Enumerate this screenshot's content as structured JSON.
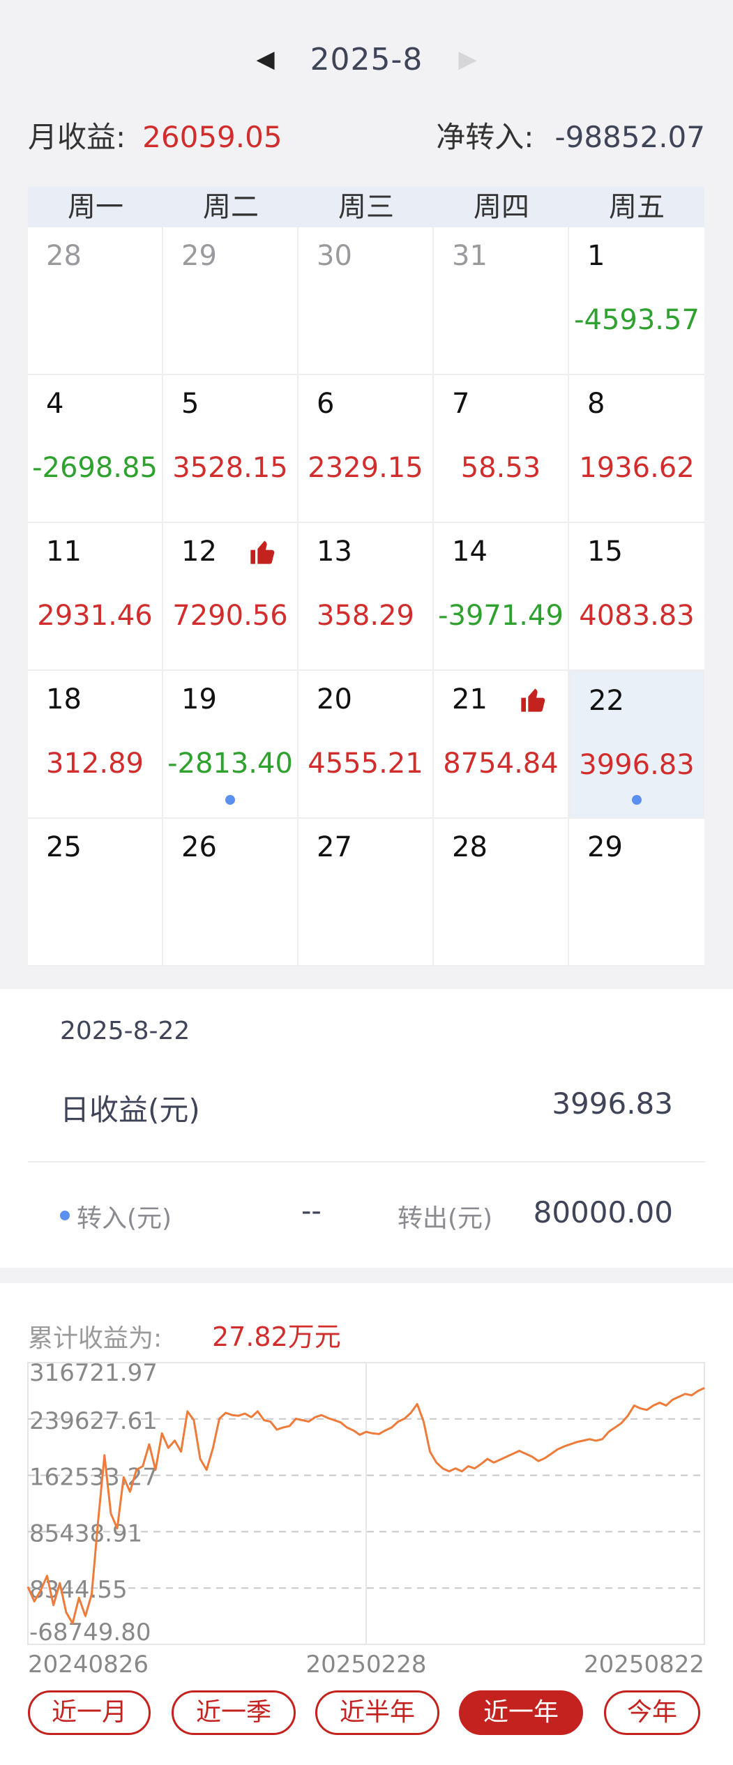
{
  "header": {
    "month": "2025-8",
    "prev_icon": "◀",
    "next_icon": "▶"
  },
  "summary": {
    "month_income_label": "月收益:",
    "month_income_value": "26059.05",
    "net_transfer_label": "净转入:",
    "net_transfer_value": "-98852.07"
  },
  "calendar": {
    "weekdays": [
      "周一",
      "周二",
      "周三",
      "周四",
      "周五"
    ],
    "days": [
      {
        "day": "28",
        "value": "",
        "other": true
      },
      {
        "day": "29",
        "value": "",
        "other": true
      },
      {
        "day": "30",
        "value": "",
        "other": true
      },
      {
        "day": "31",
        "value": "",
        "other": true
      },
      {
        "day": "1",
        "value": "-4593.57",
        "color": "green"
      },
      {
        "day": "4",
        "value": "-2698.85",
        "color": "green"
      },
      {
        "day": "5",
        "value": "3528.15",
        "color": "red"
      },
      {
        "day": "6",
        "value": "2329.15",
        "color": "red"
      },
      {
        "day": "7",
        "value": "58.53",
        "color": "red"
      },
      {
        "day": "8",
        "value": "1936.62",
        "color": "red"
      },
      {
        "day": "11",
        "value": "2931.46",
        "color": "red"
      },
      {
        "day": "12",
        "value": "7290.56",
        "color": "red",
        "thumb": true
      },
      {
        "day": "13",
        "value": "358.29",
        "color": "red"
      },
      {
        "day": "14",
        "value": "-3971.49",
        "color": "green"
      },
      {
        "day": "15",
        "value": "4083.83",
        "color": "red"
      },
      {
        "day": "18",
        "value": "312.89",
        "color": "red"
      },
      {
        "day": "19",
        "value": "-2813.40",
        "color": "green",
        "dot": true
      },
      {
        "day": "20",
        "value": "4555.21",
        "color": "red"
      },
      {
        "day": "21",
        "value": "8754.84",
        "color": "red",
        "thumb": true
      },
      {
        "day": "22",
        "value": "3996.83",
        "color": "red",
        "dot": true,
        "selected": true
      },
      {
        "day": "25",
        "value": ""
      },
      {
        "day": "26",
        "value": ""
      },
      {
        "day": "27",
        "value": ""
      },
      {
        "day": "28",
        "value": ""
      },
      {
        "day": "29",
        "value": ""
      }
    ]
  },
  "detail": {
    "date": "2025-8-22",
    "daily_income_label": "日收益(元)",
    "daily_income_value": "3996.83",
    "transfer_in_label": "转入(元)",
    "transfer_in_value": "--",
    "transfer_out_label": "转出(元)",
    "transfer_out_value": "80000.00"
  },
  "cumulative": {
    "label": "累计收益为:",
    "value": "27.82万元"
  },
  "colors": {
    "up": "#d22d2d",
    "down": "#2ea12e",
    "accent": "#c4221f",
    "line": "#ef7b3b",
    "dot": "#5b8ff0"
  },
  "chart_data": {
    "type": "line",
    "y_ticks": [
      "316721.97",
      "239627.61",
      "162533.27",
      "85438.91",
      "8344.55",
      "-68749.80"
    ],
    "x_ticks": [
      "20240826",
      "20250228",
      "20250822"
    ],
    "ylim": [
      -68749.8,
      316721.97
    ],
    "grid": true,
    "series": [
      {
        "values": [
          10000,
          -10000,
          5000,
          25000,
          -15000,
          15000,
          -25000,
          -40000,
          -5000,
          -30000,
          0,
          100000,
          190000,
          110000,
          90000,
          160000,
          140000,
          170000,
          175000,
          205000,
          170000,
          220000,
          200000,
          210000,
          195000,
          250000,
          238000,
          185000,
          170000,
          200000,
          240000,
          248000,
          245000,
          244000,
          247000,
          242000,
          250000,
          238000,
          236000,
          225000,
          228000,
          230000,
          240000,
          238000,
          236000,
          242000,
          245000,
          241000,
          238000,
          235000,
          228000,
          224000,
          218000,
          222000,
          220000,
          219000,
          224000,
          228000,
          236000,
          240000,
          248000,
          260000,
          236000,
          195000,
          180000,
          172000,
          168000,
          172000,
          168000,
          175000,
          172000,
          178000,
          185000,
          180000,
          184000,
          188000,
          192000,
          196000,
          192000,
          188000,
          182000,
          186000,
          192000,
          198000,
          202000,
          205000,
          208000,
          210000,
          212000,
          210000,
          212000,
          222000,
          228000,
          234000,
          244000,
          258000,
          254000,
          252000,
          258000,
          262000,
          258000,
          266000,
          270000,
          274000,
          272000,
          278000,
          282000
        ]
      }
    ]
  },
  "ranges": [
    {
      "label": "近一月",
      "active": false
    },
    {
      "label": "近一季",
      "active": false
    },
    {
      "label": "近半年",
      "active": false
    },
    {
      "label": "近一年",
      "active": true
    },
    {
      "label": "今年",
      "active": false
    }
  ]
}
